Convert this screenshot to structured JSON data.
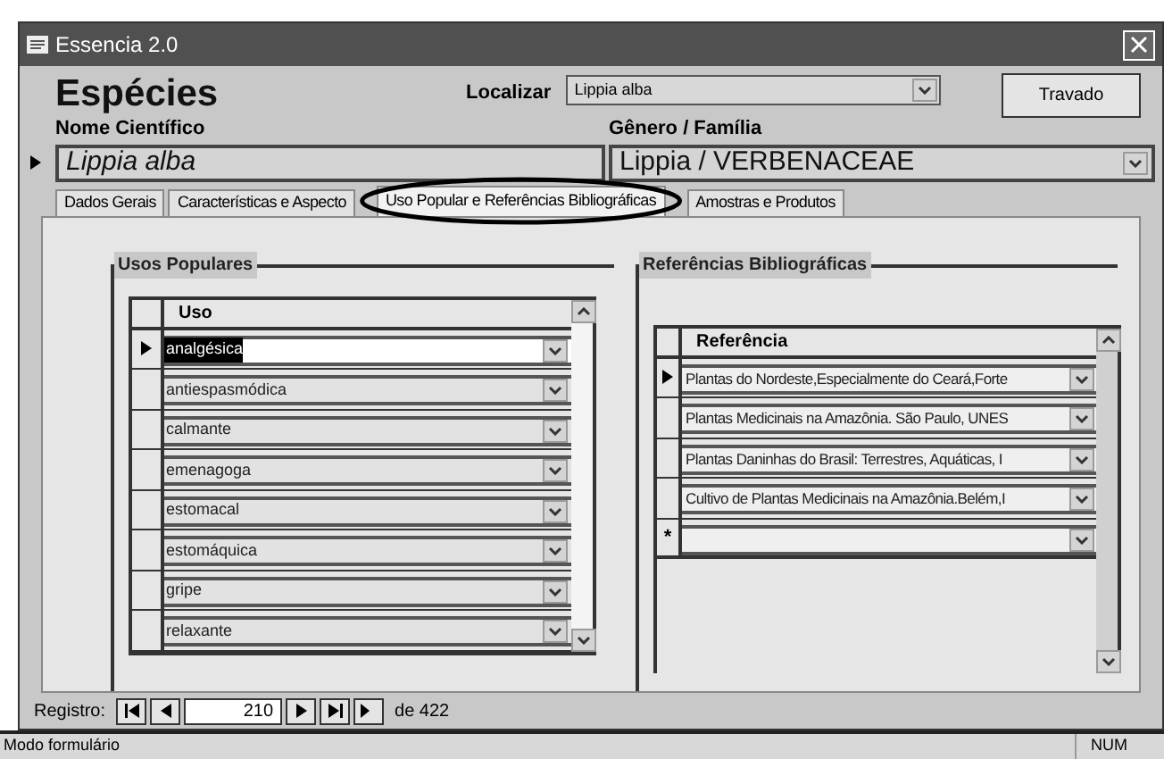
{
  "window": {
    "title": "Essencia 2.0"
  },
  "header": {
    "title": "Espécies",
    "search_label": "Localizar",
    "search_value": "Lippia alba",
    "lock_button": "Travado"
  },
  "fields": [
    {
      "label": "Nome Científico",
      "value": "Lippia alba",
      "italic": true,
      "dropdown": false
    },
    {
      "label": "Gênero / Família",
      "value": "Lippia / VERBENACEAE",
      "italic": false,
      "dropdown": true
    }
  ],
  "tabs": [
    {
      "label": "Dados Gerais",
      "selected": false
    },
    {
      "label": "Características e Aspecto",
      "selected": false
    },
    {
      "label": "Uso Popular e Referências Bibliográficas",
      "selected": true
    },
    {
      "label": "Amostras e Produtos",
      "selected": false
    }
  ],
  "usos": {
    "title": "Usos Populares",
    "column": "Uso",
    "rows": [
      {
        "value": "analgésica",
        "selected": true
      },
      {
        "value": "antiespasmódica",
        "selected": false
      },
      {
        "value": "calmante",
        "selected": false
      },
      {
        "value": "emenagoga",
        "selected": false
      },
      {
        "value": "estomacal",
        "selected": false
      },
      {
        "value": "estomáquica",
        "selected": false
      },
      {
        "value": "gripe",
        "selected": false
      },
      {
        "value": "relaxante",
        "selected": false
      }
    ]
  },
  "referencias": {
    "title": "Referências Bibliográficas",
    "column": "Referência",
    "new_row_marker": "*",
    "rows": [
      {
        "value": "Plantas do Nordeste,Especialmente do Ceará,Forte",
        "selected": true
      },
      {
        "value": "Plantas Medicinais na Amazônia. São Paulo, UNES",
        "selected": false
      },
      {
        "value": "Plantas Daninhas do Brasil: Terrestres, Aquáticas, I",
        "selected": false
      },
      {
        "value": "Cultivo de Plantas Medicinais na Amazônia.Belém,I",
        "selected": false
      }
    ]
  },
  "record_nav": {
    "label": "Registro:",
    "current": "210",
    "total": "de 422"
  },
  "status_bar": {
    "mode": "Modo formulário",
    "indicator": "NUM"
  }
}
